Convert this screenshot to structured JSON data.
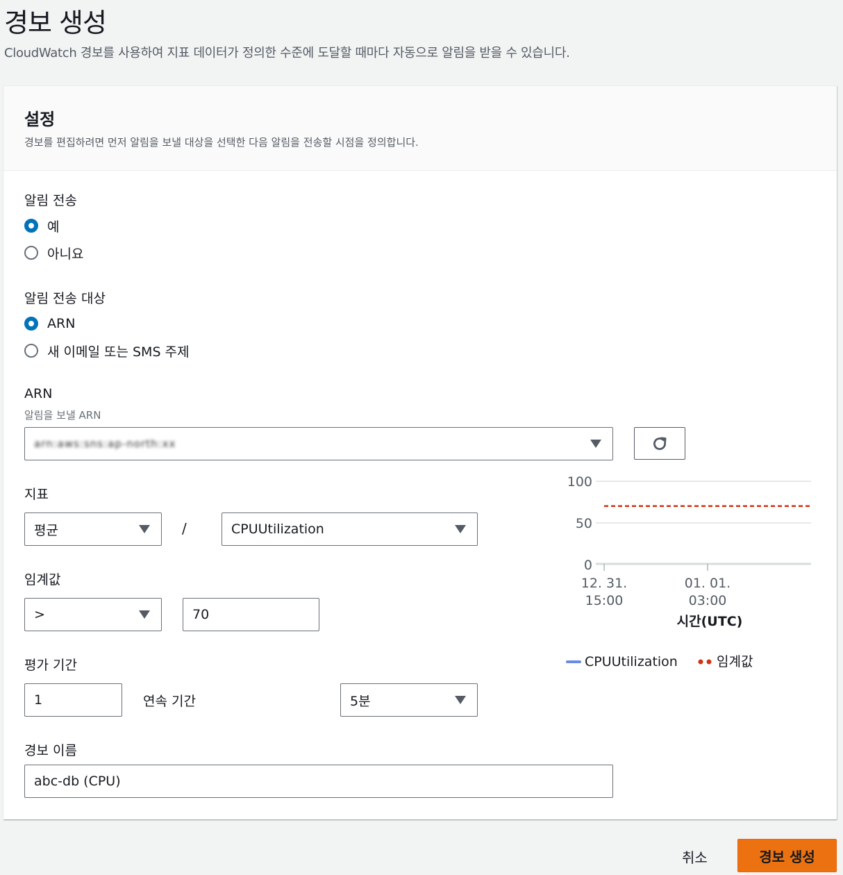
{
  "header": {
    "title": "경보 생성",
    "description": "CloudWatch 경보를 사용하여 지표 데이터가 정의한 수준에 도달할 때마다 자동으로 알림을 받을 수 있습니다."
  },
  "settings": {
    "title": "설정",
    "description": "경보를 편집하려면 먼저 알림을 보낼 대상을 선택한 다음 알림을 전송할 시점을 정의합니다.",
    "send_notification": {
      "label": "알림 전송",
      "options": [
        "예",
        "아니요"
      ],
      "selected": "예"
    },
    "notification_target": {
      "label": "알림 전송 대상",
      "options": [
        "ARN",
        "새 이메일 또는 SMS 주제"
      ],
      "selected": "ARN"
    },
    "arn": {
      "label": "ARN",
      "sublabel": "알림을 보낼 ARN",
      "value": "arn:aws:sns:ap-north:xx"
    },
    "metric": {
      "label": "지표",
      "statistic": "평균",
      "separator": "/",
      "name": "CPUUtilization"
    },
    "threshold": {
      "label": "임계값",
      "operator": ">",
      "value": "70"
    },
    "evaluation": {
      "label": "평가 기간",
      "periods": "1",
      "consecutive_label": "연속 기간",
      "period": "5분"
    },
    "alarm_name": {
      "label": "경보 이름",
      "value": "abc-db (CPU)"
    }
  },
  "chart_data": {
    "type": "line",
    "y_ticks": [
      "100",
      "50",
      "0"
    ],
    "ylim": [
      0,
      100
    ],
    "x_ticks": [
      {
        "line1": "12. 31.",
        "line2": "15:00"
      },
      {
        "line1": "01. 01.",
        "line2": "03:00"
      }
    ],
    "xlabel": "시간(UTC)",
    "threshold": 70,
    "series": [
      {
        "name": "CPUUtilization",
        "values": [],
        "color": "#688ae8"
      },
      {
        "name": "임계값",
        "values": [
          70,
          70
        ],
        "color": "#d13212"
      }
    ],
    "grid": true,
    "legend_position": "bottom"
  },
  "footer": {
    "cancel_label": "취소",
    "create_label": "경보 생성"
  },
  "colors": {
    "accent": "#0073bb",
    "primary_button": "#ec7211",
    "threshold_line": "#d13212",
    "metric_line": "#688ae8"
  },
  "icons": {
    "refresh": "refresh-icon",
    "dropdown": "caret-down-icon"
  }
}
